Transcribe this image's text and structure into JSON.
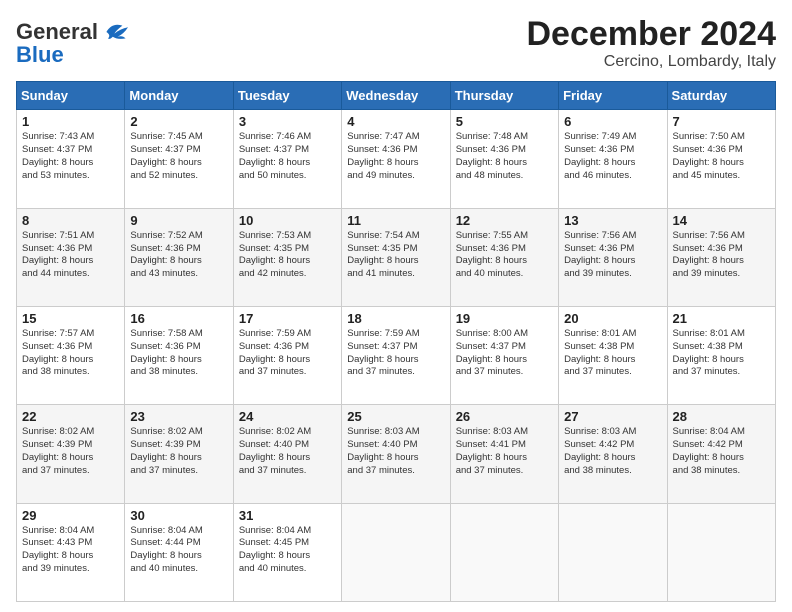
{
  "header": {
    "logo_line1": "General",
    "logo_line2": "Blue",
    "month": "December 2024",
    "location": "Cercino, Lombardy, Italy"
  },
  "weekdays": [
    "Sunday",
    "Monday",
    "Tuesday",
    "Wednesday",
    "Thursday",
    "Friday",
    "Saturday"
  ],
  "weeks": [
    [
      {
        "day": "1",
        "sunrise": "7:43 AM",
        "sunset": "4:37 PM",
        "daylight": "8 hours and 53 minutes."
      },
      {
        "day": "2",
        "sunrise": "7:45 AM",
        "sunset": "4:37 PM",
        "daylight": "8 hours and 52 minutes."
      },
      {
        "day": "3",
        "sunrise": "7:46 AM",
        "sunset": "4:37 PM",
        "daylight": "8 hours and 50 minutes."
      },
      {
        "day": "4",
        "sunrise": "7:47 AM",
        "sunset": "4:36 PM",
        "daylight": "8 hours and 49 minutes."
      },
      {
        "day": "5",
        "sunrise": "7:48 AM",
        "sunset": "4:36 PM",
        "daylight": "8 hours and 48 minutes."
      },
      {
        "day": "6",
        "sunrise": "7:49 AM",
        "sunset": "4:36 PM",
        "daylight": "8 hours and 46 minutes."
      },
      {
        "day": "7",
        "sunrise": "7:50 AM",
        "sunset": "4:36 PM",
        "daylight": "8 hours and 45 minutes."
      }
    ],
    [
      {
        "day": "8",
        "sunrise": "7:51 AM",
        "sunset": "4:36 PM",
        "daylight": "8 hours and 44 minutes."
      },
      {
        "day": "9",
        "sunrise": "7:52 AM",
        "sunset": "4:36 PM",
        "daylight": "8 hours and 43 minutes."
      },
      {
        "day": "10",
        "sunrise": "7:53 AM",
        "sunset": "4:35 PM",
        "daylight": "8 hours and 42 minutes."
      },
      {
        "day": "11",
        "sunrise": "7:54 AM",
        "sunset": "4:35 PM",
        "daylight": "8 hours and 41 minutes."
      },
      {
        "day": "12",
        "sunrise": "7:55 AM",
        "sunset": "4:36 PM",
        "daylight": "8 hours and 40 minutes."
      },
      {
        "day": "13",
        "sunrise": "7:56 AM",
        "sunset": "4:36 PM",
        "daylight": "8 hours and 39 minutes."
      },
      {
        "day": "14",
        "sunrise": "7:56 AM",
        "sunset": "4:36 PM",
        "daylight": "8 hours and 39 minutes."
      }
    ],
    [
      {
        "day": "15",
        "sunrise": "7:57 AM",
        "sunset": "4:36 PM",
        "daylight": "8 hours and 38 minutes."
      },
      {
        "day": "16",
        "sunrise": "7:58 AM",
        "sunset": "4:36 PM",
        "daylight": "8 hours and 38 minutes."
      },
      {
        "day": "17",
        "sunrise": "7:59 AM",
        "sunset": "4:36 PM",
        "daylight": "8 hours and 37 minutes."
      },
      {
        "day": "18",
        "sunrise": "7:59 AM",
        "sunset": "4:37 PM",
        "daylight": "8 hours and 37 minutes."
      },
      {
        "day": "19",
        "sunrise": "8:00 AM",
        "sunset": "4:37 PM",
        "daylight": "8 hours and 37 minutes."
      },
      {
        "day": "20",
        "sunrise": "8:01 AM",
        "sunset": "4:38 PM",
        "daylight": "8 hours and 37 minutes."
      },
      {
        "day": "21",
        "sunrise": "8:01 AM",
        "sunset": "4:38 PM",
        "daylight": "8 hours and 37 minutes."
      }
    ],
    [
      {
        "day": "22",
        "sunrise": "8:02 AM",
        "sunset": "4:39 PM",
        "daylight": "8 hours and 37 minutes."
      },
      {
        "day": "23",
        "sunrise": "8:02 AM",
        "sunset": "4:39 PM",
        "daylight": "8 hours and 37 minutes."
      },
      {
        "day": "24",
        "sunrise": "8:02 AM",
        "sunset": "4:40 PM",
        "daylight": "8 hours and 37 minutes."
      },
      {
        "day": "25",
        "sunrise": "8:03 AM",
        "sunset": "4:40 PM",
        "daylight": "8 hours and 37 minutes."
      },
      {
        "day": "26",
        "sunrise": "8:03 AM",
        "sunset": "4:41 PM",
        "daylight": "8 hours and 37 minutes."
      },
      {
        "day": "27",
        "sunrise": "8:03 AM",
        "sunset": "4:42 PM",
        "daylight": "8 hours and 38 minutes."
      },
      {
        "day": "28",
        "sunrise": "8:04 AM",
        "sunset": "4:42 PM",
        "daylight": "8 hours and 38 minutes."
      }
    ],
    [
      {
        "day": "29",
        "sunrise": "8:04 AM",
        "sunset": "4:43 PM",
        "daylight": "8 hours and 39 minutes."
      },
      {
        "day": "30",
        "sunrise": "8:04 AM",
        "sunset": "4:44 PM",
        "daylight": "8 hours and 40 minutes."
      },
      {
        "day": "31",
        "sunrise": "8:04 AM",
        "sunset": "4:45 PM",
        "daylight": "8 hours and 40 minutes."
      },
      null,
      null,
      null,
      null
    ]
  ]
}
